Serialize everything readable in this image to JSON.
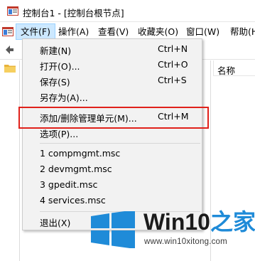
{
  "window": {
    "title": "控制台1 - [控制台根节点]"
  },
  "menubar": {
    "items": [
      "文件(F)",
      "操作(A)",
      "查看(V)",
      "收藏夹(O)",
      "窗口(W)",
      "帮助(H)"
    ]
  },
  "right_pane": {
    "column_header": "名称"
  },
  "file_menu": {
    "items": [
      {
        "label": "新建(N)",
        "shortcut": "Ctrl+N"
      },
      {
        "label": "打开(O)...",
        "shortcut": "Ctrl+O"
      },
      {
        "label": "保存(S)",
        "shortcut": "Ctrl+S"
      },
      {
        "label": "另存为(A)...",
        "shortcut": ""
      },
      {
        "label": "添加/删除管理单元(M)...",
        "shortcut": "Ctrl+M"
      },
      {
        "label": "选项(P)...",
        "shortcut": ""
      },
      {
        "label": "1 compmgmt.msc",
        "shortcut": ""
      },
      {
        "label": "2 devmgmt.msc",
        "shortcut": ""
      },
      {
        "label": "3 gpedit.msc",
        "shortcut": ""
      },
      {
        "label": "4 services.msc",
        "shortcut": ""
      },
      {
        "label": "退出(X)",
        "shortcut": ""
      }
    ]
  },
  "watermark": {
    "brand": "Win10",
    "brand_suffix": "之家",
    "url": "www.win10xitong.com"
  },
  "colors": {
    "menu_active_bg": "#cce8ff",
    "highlight_border": "#e0211b",
    "logo_blue": "#1f8bd8"
  },
  "icons": [
    "mmc-app-icon",
    "mmc-menu-icon",
    "back-arrow-icon",
    "folder-icon",
    "windows-logo-icon"
  ]
}
